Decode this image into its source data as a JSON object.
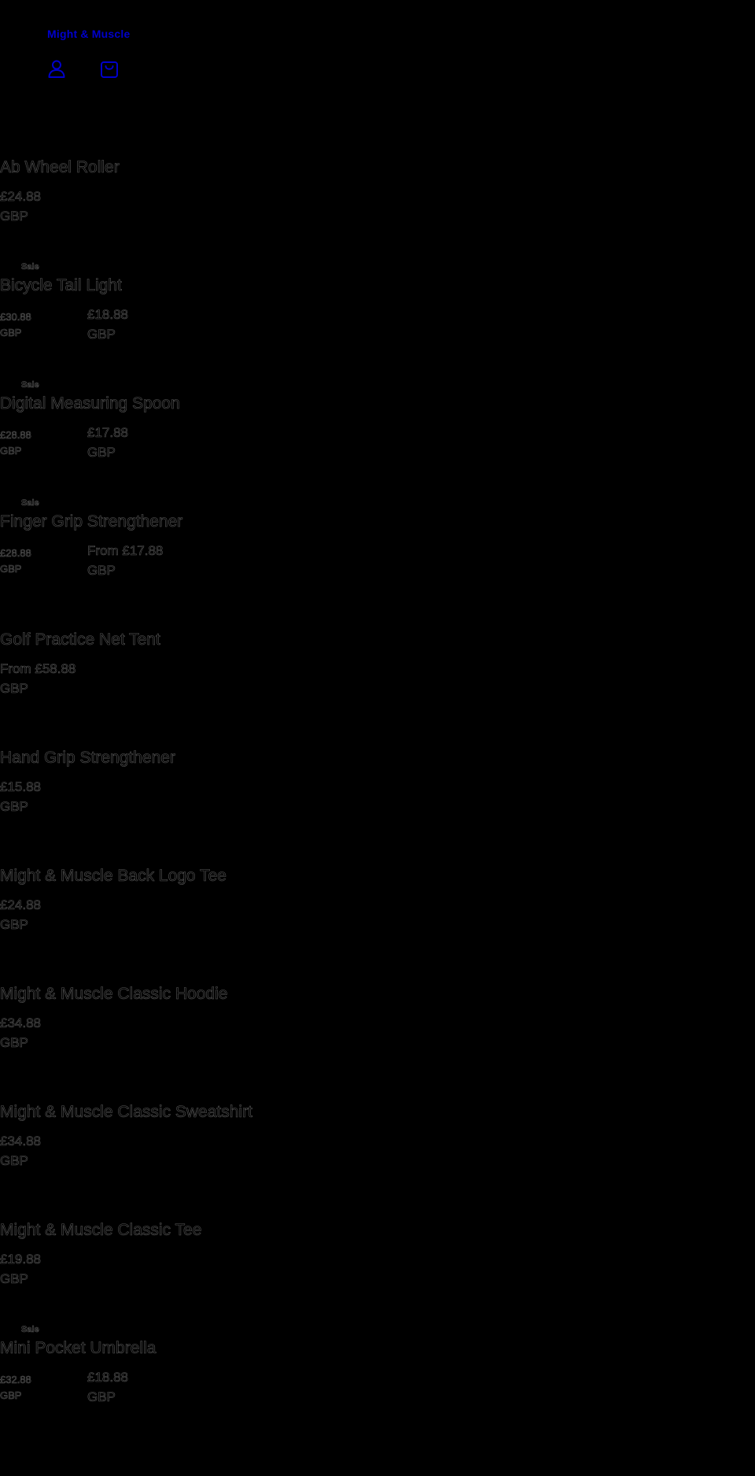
{
  "header": {
    "brand": "Might & Muscle",
    "icons": {
      "account": "person-icon",
      "cart": "bag-icon"
    },
    "link_color": "#0000cc"
  },
  "products": [
    {
      "badge": "",
      "title": "Ab Wheel Roller",
      "price": "£24.88",
      "currency": "GBP",
      "compare_price": "",
      "compare_currency": ""
    },
    {
      "badge": "Sale",
      "title": "Bicycle Tail Light",
      "price": "£18.88",
      "currency": "GBP",
      "compare_price": "£30.88",
      "compare_currency": "GBP"
    },
    {
      "badge": "Sale",
      "title": "Digital Measuring Spoon",
      "price": "£17.88",
      "currency": "GBP",
      "compare_price": "£28.88",
      "compare_currency": "GBP"
    },
    {
      "badge": "Sale",
      "title": "Finger Grip Strengthener",
      "price": "From £17.88",
      "currency": "GBP",
      "compare_price": "£28.88",
      "compare_currency": "GBP"
    },
    {
      "badge": "",
      "title": "Golf Practice Net Tent",
      "price": "From £58.88",
      "currency": "GBP",
      "compare_price": "",
      "compare_currency": ""
    },
    {
      "badge": "",
      "title": "Hand Grip Strengthener",
      "price": "£15.88",
      "currency": "GBP",
      "compare_price": "",
      "compare_currency": ""
    },
    {
      "badge": "",
      "title": "Might & Muscle Back Logo Tee",
      "price": "£24.88",
      "currency": "GBP",
      "compare_price": "",
      "compare_currency": ""
    },
    {
      "badge": "",
      "title": "Might & Muscle Classic Hoodie",
      "price": "£34.88",
      "currency": "GBP",
      "compare_price": "",
      "compare_currency": ""
    },
    {
      "badge": "",
      "title": "Might & Muscle Classic Sweatshirt",
      "price": "£34.88",
      "currency": "GBP",
      "compare_price": "",
      "compare_currency": ""
    },
    {
      "badge": "",
      "title": "Might & Muscle Classic Tee",
      "price": "£19.88",
      "currency": "GBP",
      "compare_price": "",
      "compare_currency": ""
    },
    {
      "badge": "Sale",
      "title": "Mini Pocket Umbrella",
      "price": "£18.88",
      "currency": "GBP",
      "compare_price": "£32.88",
      "compare_currency": "GBP"
    }
  ]
}
